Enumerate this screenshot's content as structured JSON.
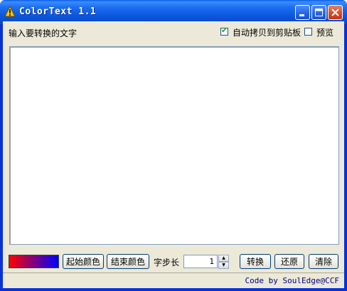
{
  "window": {
    "title": "ColorText 1.1",
    "icon": "warning-triangle-app-icon"
  },
  "title_buttons": {
    "minimize_icon": "minimize-icon",
    "maximize_icon": "maximize-icon",
    "close_icon": "close-icon"
  },
  "prompt_label": "输入要转换的文字",
  "options": {
    "auto_copy_label": "自动拷贝到剪贴板",
    "auto_copy_checked": true,
    "preview_label": "预览",
    "preview_checked": false
  },
  "text_input": {
    "value": ""
  },
  "colors": {
    "gradient_start": "#ff0000",
    "gradient_end": "#0000ff"
  },
  "toolbar": {
    "start_color_label": "起始颜色",
    "end_color_label": "结束颜色",
    "step_label": "字步长",
    "step_value": "1",
    "convert_label": "转换",
    "restore_label": "还原",
    "clear_label": "清除"
  },
  "statusbar": {
    "credit": "Code by SoulEdge@CCF"
  }
}
